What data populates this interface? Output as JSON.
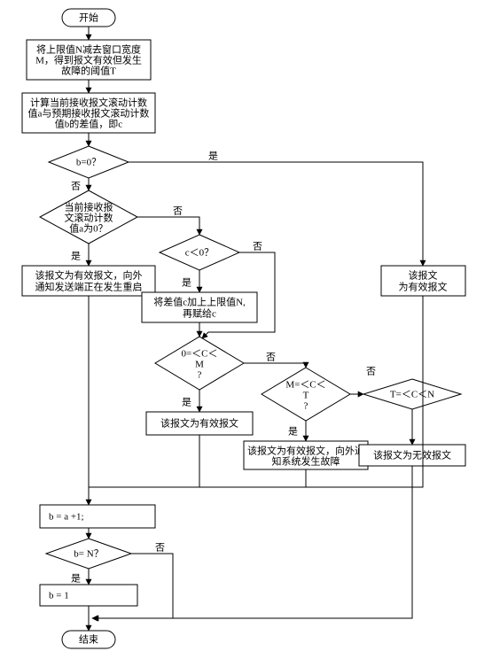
{
  "terminal": {
    "start": "开始",
    "end": "结束"
  },
  "process": {
    "calcT": [
      "将上限值N减去窗口宽度",
      "M，得到报文有效但发生",
      "故障的阈值T"
    ],
    "calcC": [
      "计算当前接收报文滚动计数",
      "值a与预期接收报文滚动计数",
      "值b的差值，即c"
    ],
    "restart": [
      "该报文为有效报文，向外",
      "通知发送端正在发生重启"
    ],
    "addN": [
      "将差值c加上上限值N,",
      "再赋给c"
    ],
    "validA": "该报文为有效报文",
    "validB": "该报文为有效报文",
    "fault": [
      "该报文为有效报文，向外通",
      "知系统发生故障"
    ],
    "invalid": "该报文为无效报文",
    "incB": "b = a +1;",
    "resetB": "b = 1"
  },
  "decision": {
    "bZero": "b=0？",
    "aZero": [
      "当前接收报",
      "文滚动计数",
      "值a为0？"
    ],
    "cNeg": "c＜0？",
    "cRange1": [
      "0=＜C＜",
      "M",
      "?"
    ],
    "cRange2": [
      "M=＜C＜",
      "T",
      "?"
    ],
    "cRange3": "T=＜C＜N",
    "bEqN": "b= N？"
  },
  "edge": {
    "yes": "是",
    "no": "否"
  },
  "chart_data": {
    "type": "flowchart",
    "title": "",
    "nodes": [
      {
        "id": "start",
        "kind": "terminator",
        "text": "开始"
      },
      {
        "id": "calcT",
        "kind": "process",
        "text": "将上限值N减去窗口宽度M，得到报文有效但发生故障的阈值T"
      },
      {
        "id": "calcC",
        "kind": "process",
        "text": "计算当前接收报文滚动计数值a与预期接收报文滚动计数值b的差值，即c"
      },
      {
        "id": "bZero",
        "kind": "decision",
        "text": "b=0？"
      },
      {
        "id": "aZero",
        "kind": "decision",
        "text": "当前接收报文滚动计数值a为0？"
      },
      {
        "id": "restart",
        "kind": "process",
        "text": "该报文为有效报文，向外通知发送端正在发生重启"
      },
      {
        "id": "validB",
        "kind": "process",
        "text": "该报文为有效报文"
      },
      {
        "id": "cNeg",
        "kind": "decision",
        "text": "c＜0？"
      },
      {
        "id": "addN",
        "kind": "process",
        "text": "将差值c加上上限值N,再赋给c"
      },
      {
        "id": "cRange1",
        "kind": "decision",
        "text": "0=＜C＜M?"
      },
      {
        "id": "validA",
        "kind": "process",
        "text": "该报文为有效报文"
      },
      {
        "id": "cRange2",
        "kind": "decision",
        "text": "M=＜C＜T?"
      },
      {
        "id": "fault",
        "kind": "process",
        "text": "该报文为有效报文，向外通知系统发生故障"
      },
      {
        "id": "cRange3",
        "kind": "decision",
        "text": "T=＜C＜N"
      },
      {
        "id": "invalid",
        "kind": "process",
        "text": "该报文为无效报文"
      },
      {
        "id": "incB",
        "kind": "process",
        "text": "b = a +1;"
      },
      {
        "id": "bEqN",
        "kind": "decision",
        "text": "b= N？"
      },
      {
        "id": "resetB",
        "kind": "process",
        "text": "b = 1"
      },
      {
        "id": "end",
        "kind": "terminator",
        "text": "结束"
      }
    ],
    "edges": [
      {
        "from": "start",
        "to": "calcT"
      },
      {
        "from": "calcT",
        "to": "calcC"
      },
      {
        "from": "calcC",
        "to": "bZero"
      },
      {
        "from": "bZero",
        "to": "validB",
        "label": "是"
      },
      {
        "from": "bZero",
        "to": "aZero",
        "label": "否"
      },
      {
        "from": "aZero",
        "to": "restart",
        "label": "是"
      },
      {
        "from": "aZero",
        "to": "cNeg",
        "label": "否"
      },
      {
        "from": "cNeg",
        "to": "addN",
        "label": "是"
      },
      {
        "from": "cNeg",
        "to": "cRange1",
        "label": "否"
      },
      {
        "from": "addN",
        "to": "cRange1"
      },
      {
        "from": "cRange1",
        "to": "validA",
        "label": "是"
      },
      {
        "from": "cRange1",
        "to": "cRange2",
        "label": "否"
      },
      {
        "from": "cRange2",
        "to": "fault",
        "label": "是"
      },
      {
        "from": "cRange2",
        "to": "cRange3",
        "label": "否"
      },
      {
        "from": "cRange3",
        "to": "invalid"
      },
      {
        "from": "restart",
        "to": "incB"
      },
      {
        "from": "validA",
        "to": "incB"
      },
      {
        "from": "fault",
        "to": "incB"
      },
      {
        "from": "validB",
        "to": "incB"
      },
      {
        "from": "incB",
        "to": "bEqN"
      },
      {
        "from": "bEqN",
        "to": "resetB",
        "label": "是"
      },
      {
        "from": "bEqN",
        "to": "end",
        "label": "否"
      },
      {
        "from": "resetB",
        "to": "end"
      },
      {
        "from": "invalid",
        "to": "end"
      }
    ]
  }
}
